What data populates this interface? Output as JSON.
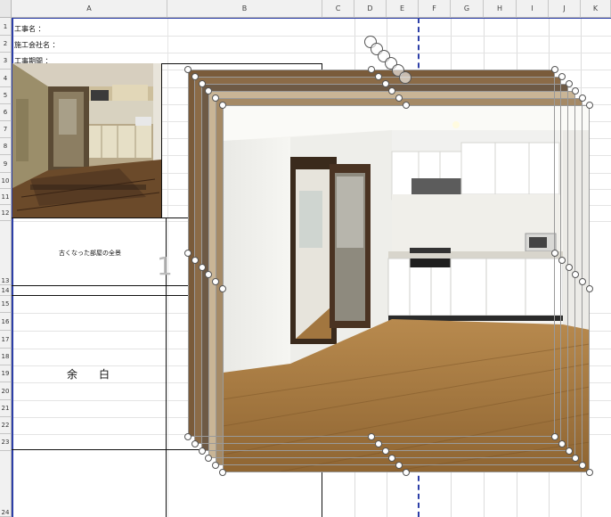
{
  "columns": [
    "A",
    "B",
    "C",
    "D",
    "E",
    "F",
    "G",
    "H",
    "I",
    "J",
    "K"
  ],
  "rows": [
    "1",
    "2",
    "3",
    "4",
    "5",
    "6",
    "7",
    "8",
    "9",
    "10",
    "11",
    "12",
    "13",
    "14",
    "15",
    "16",
    "17",
    "18",
    "19",
    "20",
    "21",
    "22",
    "23",
    "24"
  ],
  "header_labels": {
    "project_name": "工事名 ：",
    "contractor": "施工会社名 ：",
    "period": "工事期間 ："
  },
  "captions": {
    "before_photo": "古くなった部屋の全景",
    "blank": "余　白",
    "page_number_fragment": "1"
  },
  "colors": {
    "page_break": "#2d3fa8",
    "header_bg": "#f1f1f1",
    "grid": "#dcdcdc"
  }
}
